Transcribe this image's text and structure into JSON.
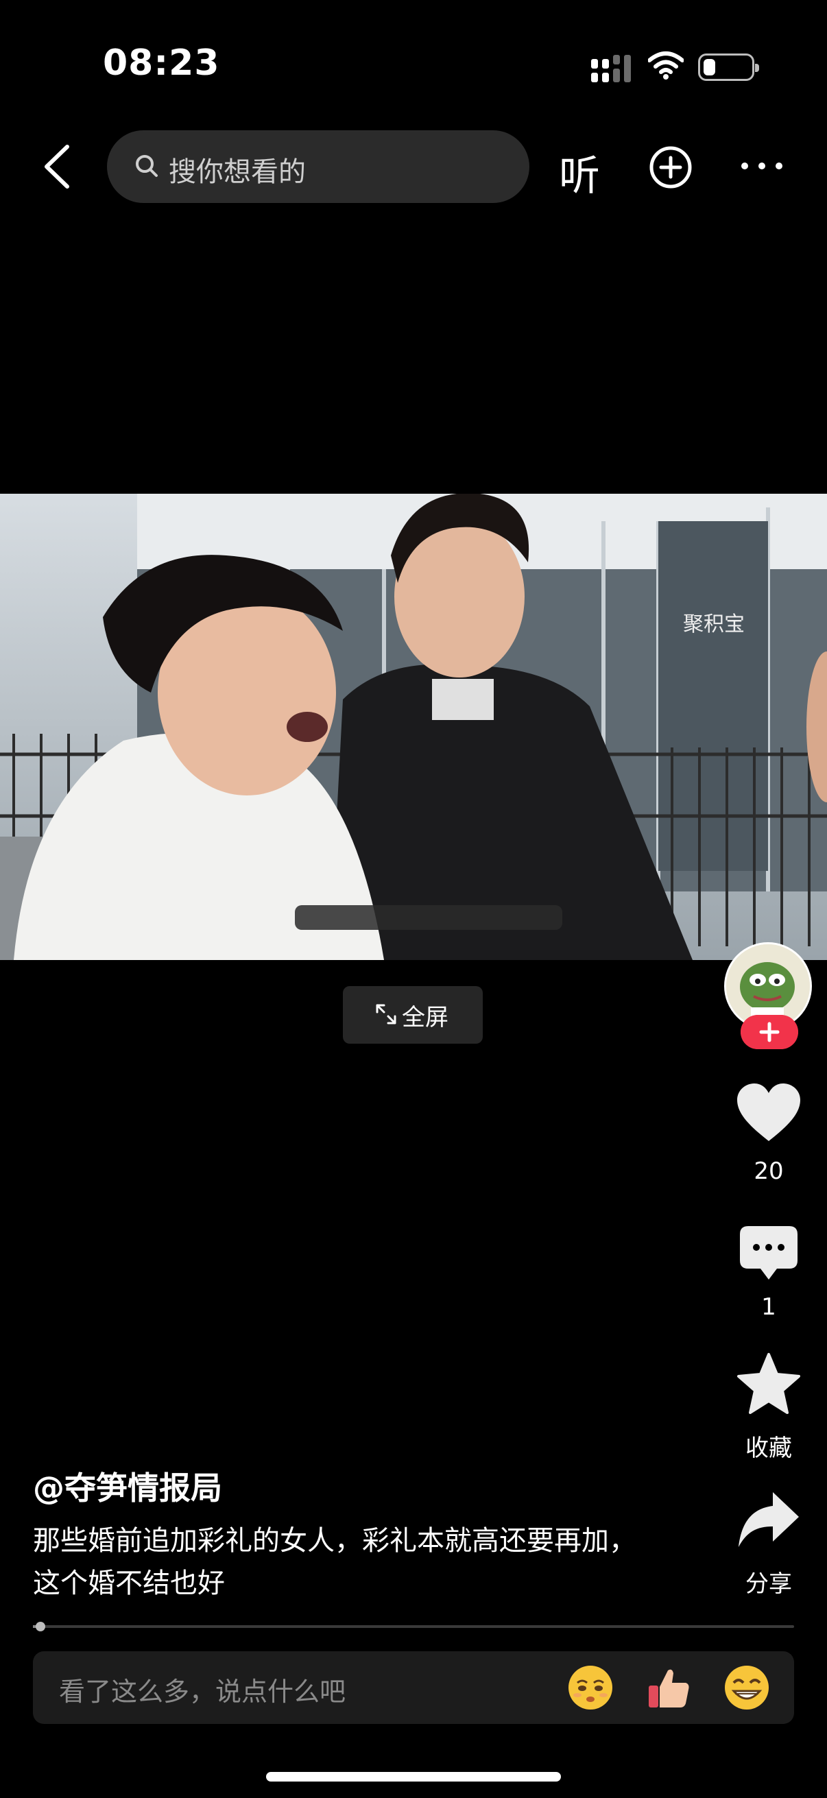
{
  "status_bar": {
    "time": "08:23",
    "icons": [
      "signal-icon",
      "wifi-icon",
      "battery-icon"
    ],
    "battery_level": 0.25
  },
  "top_nav": {
    "back_icon": "chevron-left-icon",
    "search_placeholder": "搜你想看的",
    "listen_label": "听",
    "add_icon": "plus-circle-icon",
    "more_icon": "ellipsis-icon"
  },
  "video": {
    "fullscreen_label": "全屏",
    "fullscreen_icon": "expand-icon"
  },
  "actions": {
    "follow_icon": "plus-icon",
    "like_count": "20",
    "comment_count": "1",
    "favorite_label": "收藏",
    "share_label": "分享"
  },
  "post": {
    "author": "@夺笋情报局",
    "caption_line1": "那些婚前追加彩礼的女人，彩礼本就高还要再加，",
    "caption_line2": "这个婚不结也好",
    "progress": 0.01
  },
  "comment_bar": {
    "placeholder": "看了这么多，说点什么吧",
    "emojis": [
      "pleading-face-emoji",
      "thumbs-up-emoji",
      "grinning-face-emoji"
    ]
  },
  "colors": {
    "background": "#000000",
    "accent": "#f2334a",
    "search_bg": "#2b2b2b",
    "comment_bg": "#1c1c1c"
  }
}
